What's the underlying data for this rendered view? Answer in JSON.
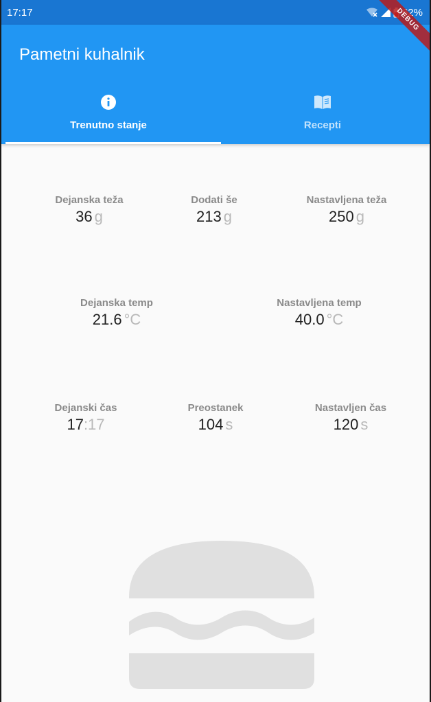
{
  "status_bar": {
    "time": "17:17",
    "battery": "62%",
    "icons": [
      "wifi-off-icon",
      "signal-icon",
      "battery-low-icon"
    ]
  },
  "debug_banner": "DEBUG",
  "app_bar": {
    "title": "Pametni kuhalnik",
    "tabs": [
      {
        "label": "Trenutno stanje",
        "icon": "info-icon",
        "selected": true
      },
      {
        "label": "Recepti",
        "icon": "book-icon",
        "selected": false
      }
    ]
  },
  "readings": {
    "weight": {
      "actual": {
        "label": "Dejanska teža",
        "value": "36",
        "unit": "g"
      },
      "remaining": {
        "label": "Dodati še",
        "value": "213",
        "unit": "g"
      },
      "target": {
        "label": "Nastavljena teža",
        "value": "250",
        "unit": "g"
      }
    },
    "temperature": {
      "actual": {
        "label": "Dejanska temp",
        "value": "21.6",
        "unit": "°C"
      },
      "target": {
        "label": "Nastavljena temp",
        "value": "40.0",
        "unit": "°C"
      }
    },
    "time": {
      "actual": {
        "label": "Dejanski čas",
        "value": "17",
        "unit": ":17"
      },
      "remaining": {
        "label": "Preostanek",
        "value": "104",
        "unit": "s"
      },
      "target": {
        "label": "Nastavljen čas",
        "value": "120",
        "unit": "s"
      }
    }
  },
  "illustration": {
    "icon": "burger-icon",
    "color": "#e0e0e0"
  },
  "colors": {
    "primary": "#2196f3",
    "status_bar": "#1976d2",
    "label": "#8a8a8a",
    "unit": "#b8b8b8",
    "background": "#fafafa"
  }
}
